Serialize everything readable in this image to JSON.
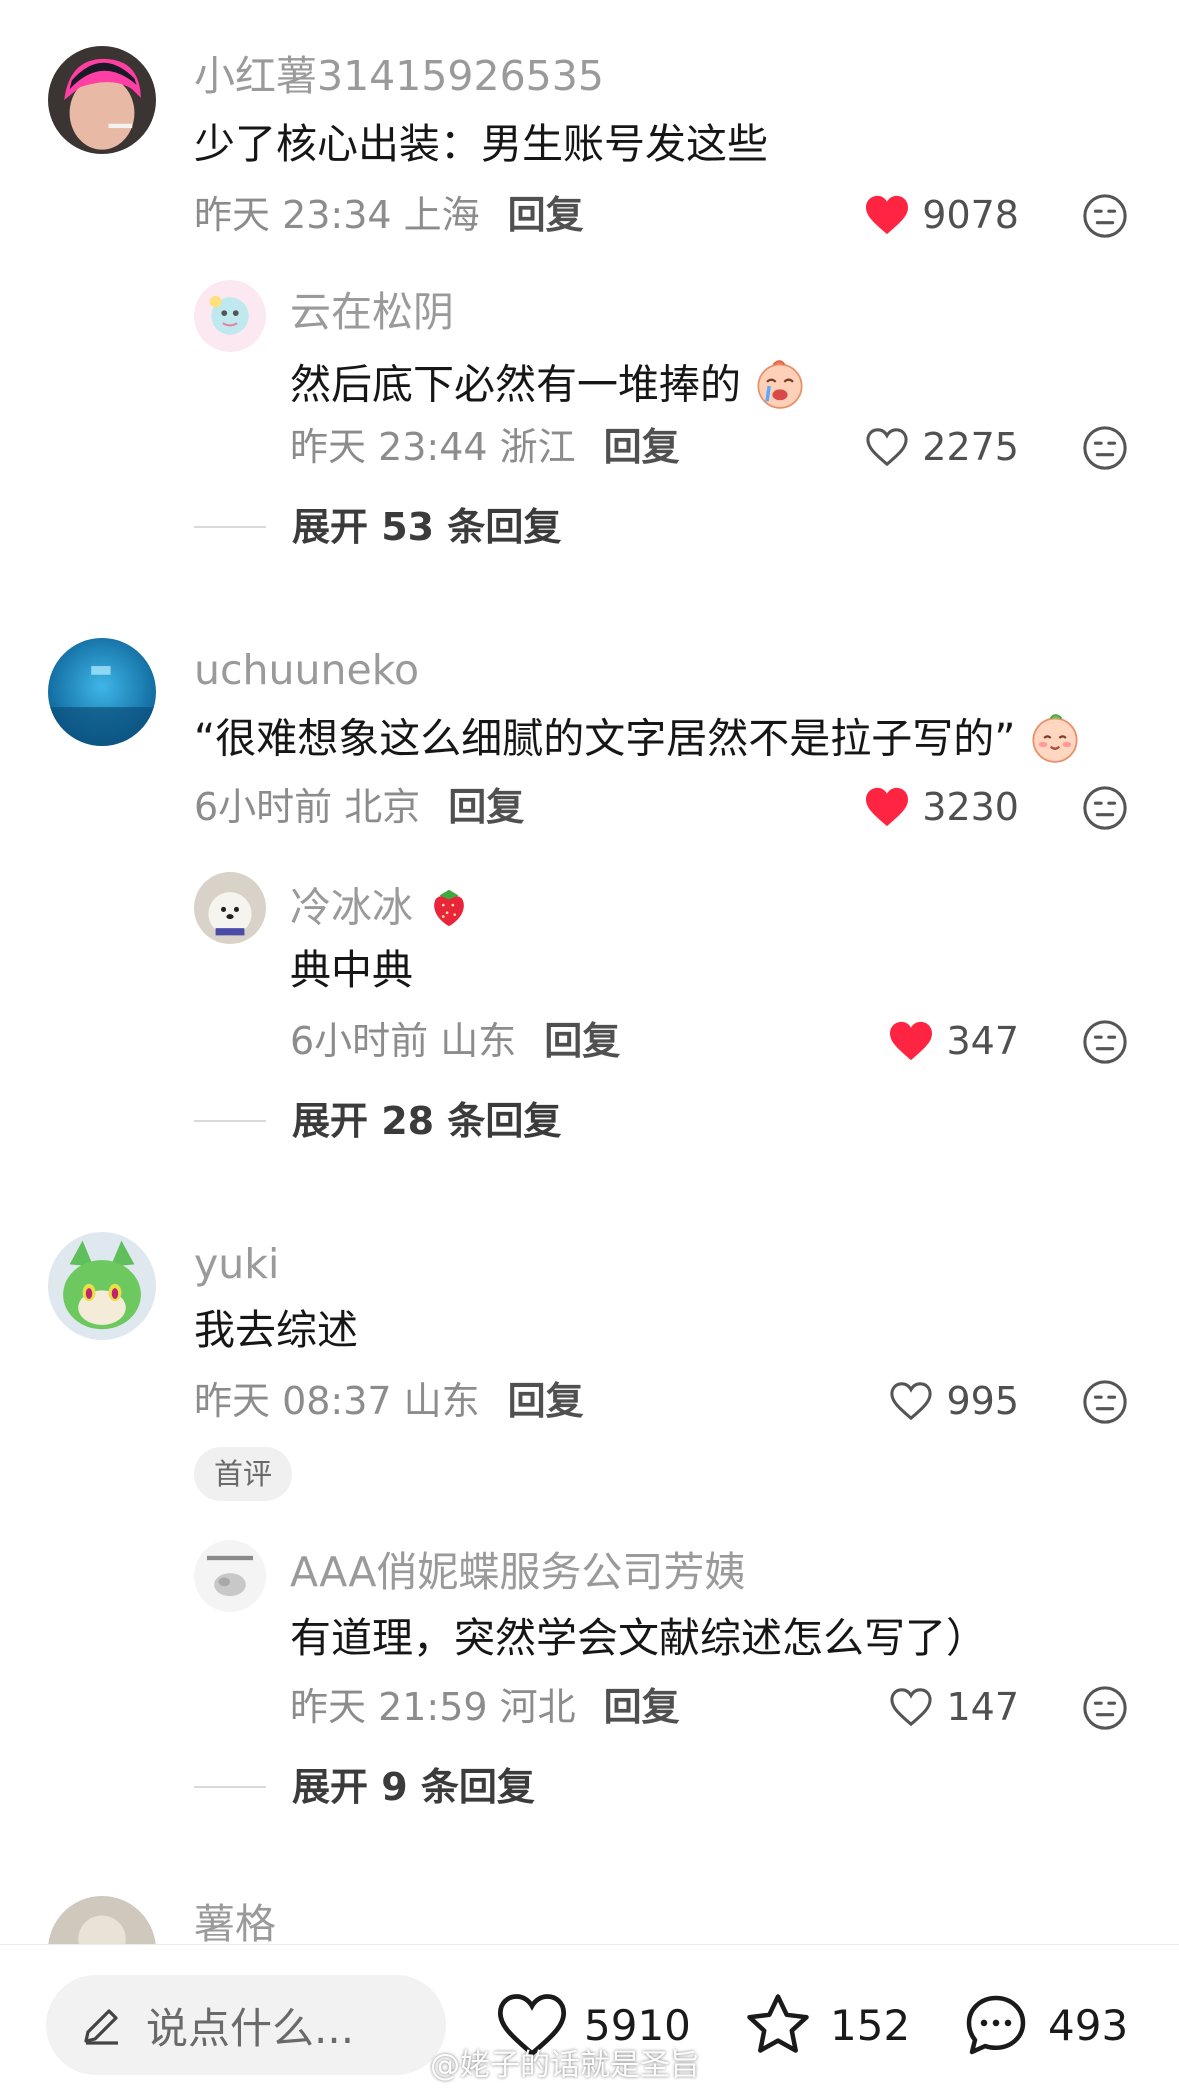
{
  "comments": [
    {
      "user": "小红薯31415926535",
      "text": "少了核心出装：男生账号发这些",
      "time": "昨天 23:34 上海",
      "reply_label": "回复",
      "likes": "9078",
      "liked": true,
      "reply": {
        "user": "云在松阴",
        "text": "然后底下必然有一堆捧的",
        "time": "昨天 23:44 浙江",
        "reply_label": "回复",
        "likes": "2275",
        "liked": false
      },
      "expand": "展开 53 条回复"
    },
    {
      "user": "uchuuneko",
      "text": "“很难想象这么细腻的文字居然不是拉子写的”",
      "time": "6小时前 北京",
      "reply_label": "回复",
      "likes": "3230",
      "liked": true,
      "reply": {
        "user": "冷冰冰",
        "text": "典中典",
        "time": "6小时前 山东",
        "reply_label": "回复",
        "likes": "347",
        "liked": true
      },
      "expand": "展开 28 条回复"
    },
    {
      "user": "yuki",
      "text": "我去综述",
      "time": "昨天 08:37 山东",
      "reply_label": "回复",
      "likes": "995",
      "liked": false,
      "tag": "首评",
      "reply": {
        "user": "AAA俏妮蝶服务公司芳姨",
        "text": "有道理，突然学会文献综述怎么写了）",
        "time": "昨天 21:59 河北",
        "reply_label": "回复",
        "likes": "147",
        "liked": false
      },
      "expand": "展开 9 条回复"
    },
    {
      "user": "薯格"
    }
  ],
  "bottom_bar": {
    "placeholder": "说点什么...",
    "likes": "5910",
    "favorites": "152",
    "comments": "493"
  },
  "watermark": "@姥子的话就是圣旨",
  "colors": {
    "like_red": "#ff2442",
    "meta_gray": "#8c8c8c",
    "name_gray": "#9a9a9a"
  }
}
